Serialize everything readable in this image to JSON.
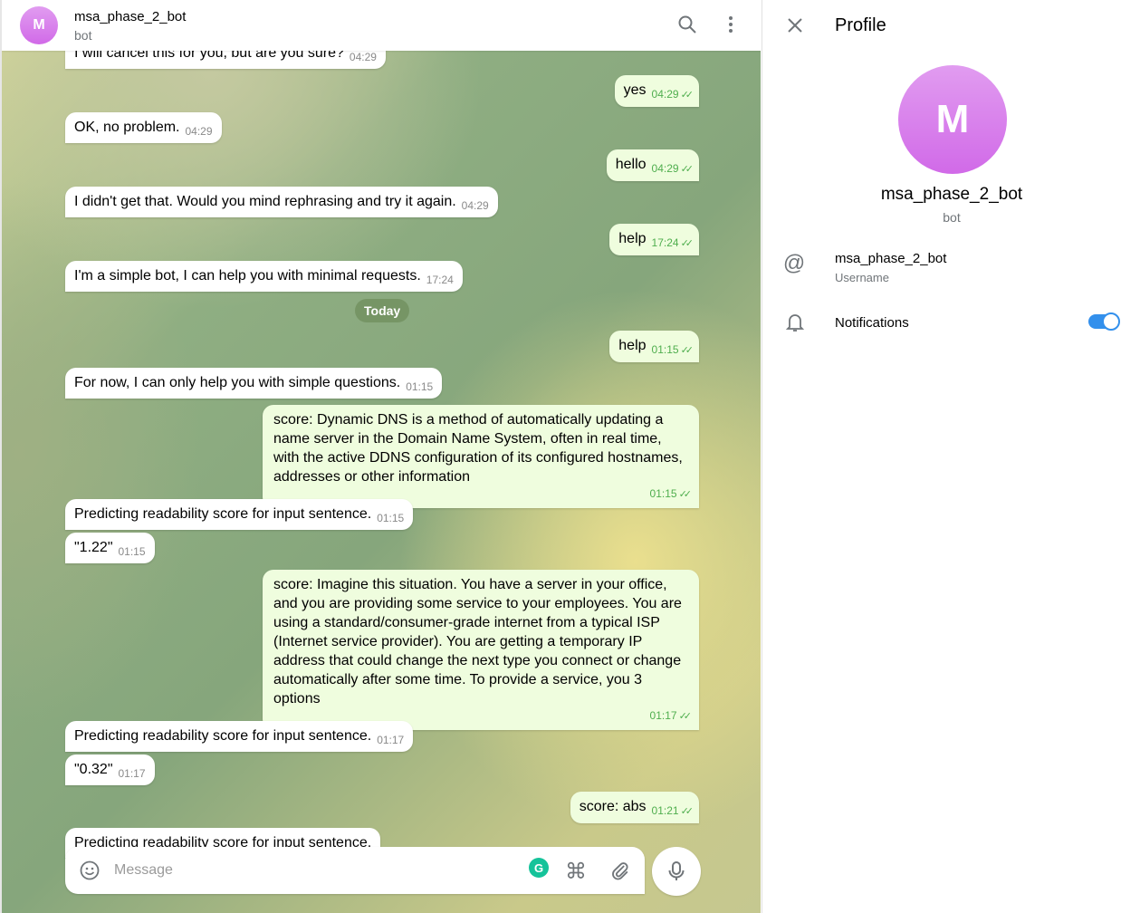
{
  "header": {
    "avatar_letter": "M",
    "name": "msa_phase_2_bot",
    "status": "bot"
  },
  "messages": [
    {
      "dir": "in",
      "text": "I will cancel this for you, but are you sure?",
      "time": "04:29"
    },
    {
      "dir": "out",
      "text": "yes",
      "time": "04:29"
    },
    {
      "dir": "in",
      "text": "OK, no problem.",
      "time": "04:29"
    },
    {
      "dir": "out",
      "text": "hello",
      "time": "04:29"
    },
    {
      "dir": "in",
      "text": "I didn't get that. Would you mind rephrasing and try it again.",
      "time": "04:29"
    },
    {
      "dir": "out",
      "text": "help",
      "time": "17:24"
    },
    {
      "dir": "in",
      "text": "I'm a simple bot, I can help you with minimal requests.",
      "time": "17:24"
    },
    {
      "dir": "out",
      "text": "help",
      "time": "01:15"
    },
    {
      "dir": "in",
      "text": "For now, I can only help you with simple questions.",
      "time": "01:15"
    },
    {
      "dir": "out",
      "text": "score: Dynamic DNS is a method of automatically updating a name server in the Domain Name System, often in real time, with the active DDNS configuration of its configured hostnames, addresses or other information",
      "time": "01:15"
    },
    {
      "dir": "in",
      "text": "Predicting readability score for input sentence.",
      "time": "01:15"
    },
    {
      "dir": "in",
      "text": "\"1.22\"",
      "time": "01:15"
    },
    {
      "dir": "out",
      "text": "score: Imagine this situation. You have a server in your office, and you are providing some service to your employees. You are using a standard/consumer-grade internet from a typical ISP (Internet service provider). You are getting a temporary IP address that could change the next type you connect or change automatically after some time. To provide a service, you 3 options",
      "time": "01:17"
    },
    {
      "dir": "in",
      "text": "Predicting readability score for input sentence.",
      "time": "01:17"
    },
    {
      "dir": "in",
      "text": "\"0.32\"",
      "time": "01:17"
    },
    {
      "dir": "out",
      "text": "score: abs",
      "time": "01:21"
    },
    {
      "dir": "in",
      "text": "Predicting readability score for input sentence.",
      "time": ""
    }
  ],
  "date_separator": "Today",
  "composer": {
    "placeholder": "Message"
  },
  "profile": {
    "title": "Profile",
    "avatar_letter": "M",
    "name": "msa_phase_2_bot",
    "status": "bot",
    "username": "msa_phase_2_bot",
    "username_label": "Username",
    "notifications_label": "Notifications",
    "notifications_on": true
  }
}
